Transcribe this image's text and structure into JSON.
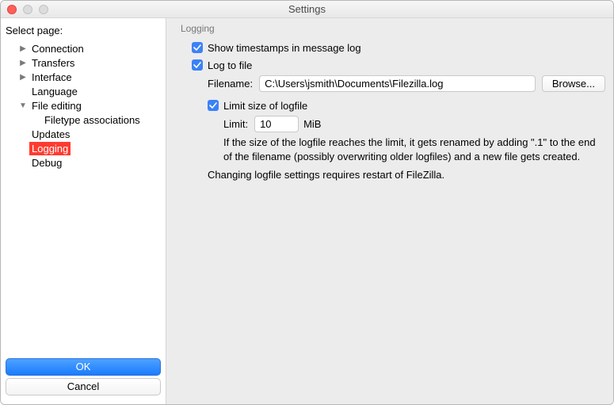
{
  "window": {
    "title": "Settings"
  },
  "sidebar": {
    "label": "Select page:",
    "items": [
      {
        "label": "Connection",
        "expandable": true,
        "expanded": false,
        "level": 1
      },
      {
        "label": "Transfers",
        "expandable": true,
        "expanded": false,
        "level": 1
      },
      {
        "label": "Interface",
        "expandable": true,
        "expanded": false,
        "level": 1
      },
      {
        "label": "Language",
        "expandable": false,
        "level": 1
      },
      {
        "label": "File editing",
        "expandable": true,
        "expanded": true,
        "level": 1
      },
      {
        "label": "Filetype associations",
        "expandable": false,
        "level": 2
      },
      {
        "label": "Updates",
        "expandable": false,
        "level": 1
      },
      {
        "label": "Logging",
        "expandable": false,
        "level": 1,
        "selected": true
      },
      {
        "label": "Debug",
        "expandable": false,
        "level": 1
      }
    ],
    "ok": "OK",
    "cancel": "Cancel"
  },
  "panel": {
    "title": "Logging",
    "show_timestamps": {
      "label": "Show timestamps in message log",
      "checked": true
    },
    "log_to_file": {
      "label": "Log to file",
      "checked": true
    },
    "filename": {
      "label": "Filename:",
      "value": "C:\\Users\\jsmith\\Documents\\Filezilla.log"
    },
    "browse": "Browse...",
    "limit_size": {
      "label": "Limit size of logfile",
      "checked": true
    },
    "limit": {
      "label": "Limit:",
      "value": "10",
      "unit": "MiB"
    },
    "info": "If the size of the logfile reaches the limit, it gets renamed by adding \".1\" to the end of the filename (possibly overwriting older logfiles) and a new file gets created.",
    "restart_note": "Changing logfile settings requires restart of FileZilla."
  }
}
